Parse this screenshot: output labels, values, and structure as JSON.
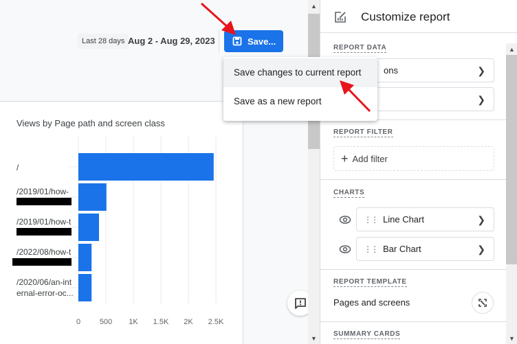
{
  "toolbar": {
    "date_preset": "Last 28 days",
    "date_range": "Aug 2 - Aug 29, 2023",
    "save_label": "Save...",
    "save_menu": [
      {
        "label": "Save changes to current report"
      },
      {
        "label": "Save as a new report"
      }
    ]
  },
  "colors": {
    "accent": "#1a73e8",
    "annotation_arrow": "#e8141c"
  },
  "chart_data": {
    "type": "bar",
    "orientation": "horizontal",
    "title": "Views by Page path and screen class",
    "categories": [
      "/",
      "/2019/01/how-",
      "/2019/01/how-t",
      "/2022/08/how-t",
      "/2020/06/an-internal-error-oc..."
    ],
    "category_lines": [
      [
        "/"
      ],
      [
        "/2019/01/how-",
        "[redacted]"
      ],
      [
        "/2019/01/how-t",
        "[redacted]"
      ],
      [
        "/2022/08/how-t",
        "[redacted]"
      ],
      [
        "/2020/06/an-int",
        "ernal-error-oc..."
      ]
    ],
    "redacted": [
      false,
      true,
      true,
      true,
      false
    ],
    "values": [
      2460,
      510,
      375,
      240,
      240
    ],
    "xlim": [
      0,
      2750
    ],
    "xticks": [
      0,
      500,
      1000,
      1500,
      2000,
      2500
    ],
    "xtick_labels": [
      "0",
      "500",
      "1K",
      "1.5K",
      "2K",
      "2.5K"
    ],
    "grid": true,
    "bar_color": "#1a73e8"
  },
  "panel": {
    "title": "Customize report",
    "report_data": {
      "label": "REPORT DATA",
      "items": [
        {
          "label": "ons"
        },
        {
          "label": ""
        }
      ]
    },
    "report_filter": {
      "label": "REPORT FILTER",
      "add_filter": "Add filter"
    },
    "charts": {
      "label": "CHARTS",
      "items": [
        {
          "label": "Line Chart",
          "visible": true
        },
        {
          "label": "Bar Chart",
          "visible": true
        }
      ]
    },
    "report_template": {
      "label": "REPORT TEMPLATE",
      "name": "Pages and screens"
    },
    "summary_cards": {
      "label": "SUMMARY CARDS"
    }
  }
}
